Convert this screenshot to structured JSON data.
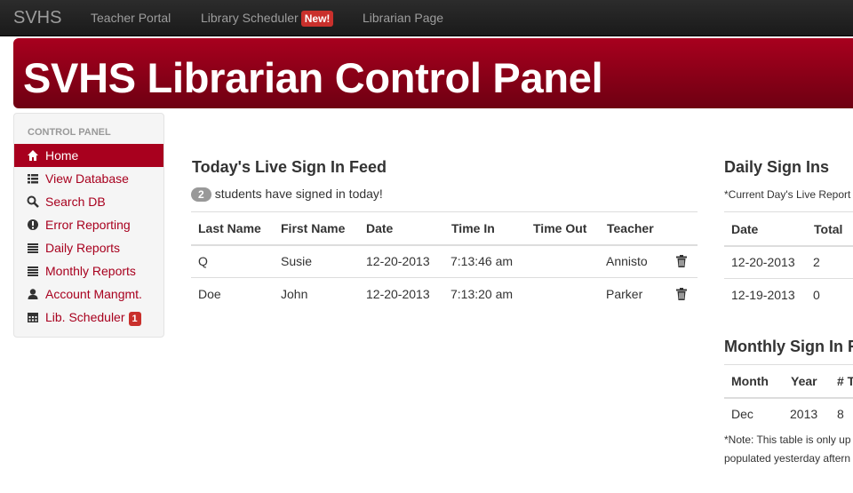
{
  "navbar": {
    "brand": "SVHS",
    "links": [
      {
        "label": "Teacher Portal"
      },
      {
        "label": "Library Scheduler",
        "badge": "New!"
      },
      {
        "label": "Librarian Page"
      }
    ]
  },
  "hero": {
    "title": "SVHS Librarian Control Panel"
  },
  "sidebar": {
    "header": "Control Panel",
    "items": [
      {
        "label": "Home",
        "icon": "home-icon",
        "active": true
      },
      {
        "label": "View Database",
        "icon": "list-icon"
      },
      {
        "label": "Search DB",
        "icon": "search-icon"
      },
      {
        "label": "Error Reporting",
        "icon": "exclamation-circle-icon"
      },
      {
        "label": "Daily Reports",
        "icon": "report-list-icon"
      },
      {
        "label": "Monthly Reports",
        "icon": "report-list-icon"
      },
      {
        "label": "Account Mangmt.",
        "icon": "user-icon"
      },
      {
        "label": "Lib. Scheduler",
        "icon": "calendar-icon",
        "badge": "1"
      }
    ]
  },
  "live_feed": {
    "title": "Today's Live Sign In Feed",
    "count": "2",
    "count_text": "students have signed in today!",
    "columns": [
      "Last Name",
      "First Name",
      "Date",
      "Time In",
      "Time Out",
      "Teacher"
    ],
    "rows": [
      {
        "last": "Q",
        "first": "Susie",
        "date": "12-20-2013",
        "time_in": "7:13:46 am",
        "time_out": "",
        "teacher": "Annisto"
      },
      {
        "last": "Doe",
        "first": "John",
        "date": "12-20-2013",
        "time_in": "7:13:20 am",
        "time_out": "",
        "teacher": "Parker"
      }
    ]
  },
  "daily": {
    "title": "Daily Sign Ins",
    "note": "*Current Day's Live Report",
    "columns": [
      "Date",
      "Total"
    ],
    "rows": [
      {
        "date": "12-20-2013",
        "total": "2"
      },
      {
        "date": "12-19-2013",
        "total": "0"
      }
    ]
  },
  "monthly": {
    "title": "Monthly Sign In R",
    "columns": [
      "Month",
      "Year",
      "# T"
    ],
    "rows": [
      {
        "month": "Dec",
        "year": "2013",
        "total": "8"
      }
    ],
    "note_line1": "*Note: This table is only up",
    "note_line2": "populated yesterday aftern"
  },
  "colors": {
    "brand_red": "#a8001e",
    "navbar_bg": "#222222"
  }
}
